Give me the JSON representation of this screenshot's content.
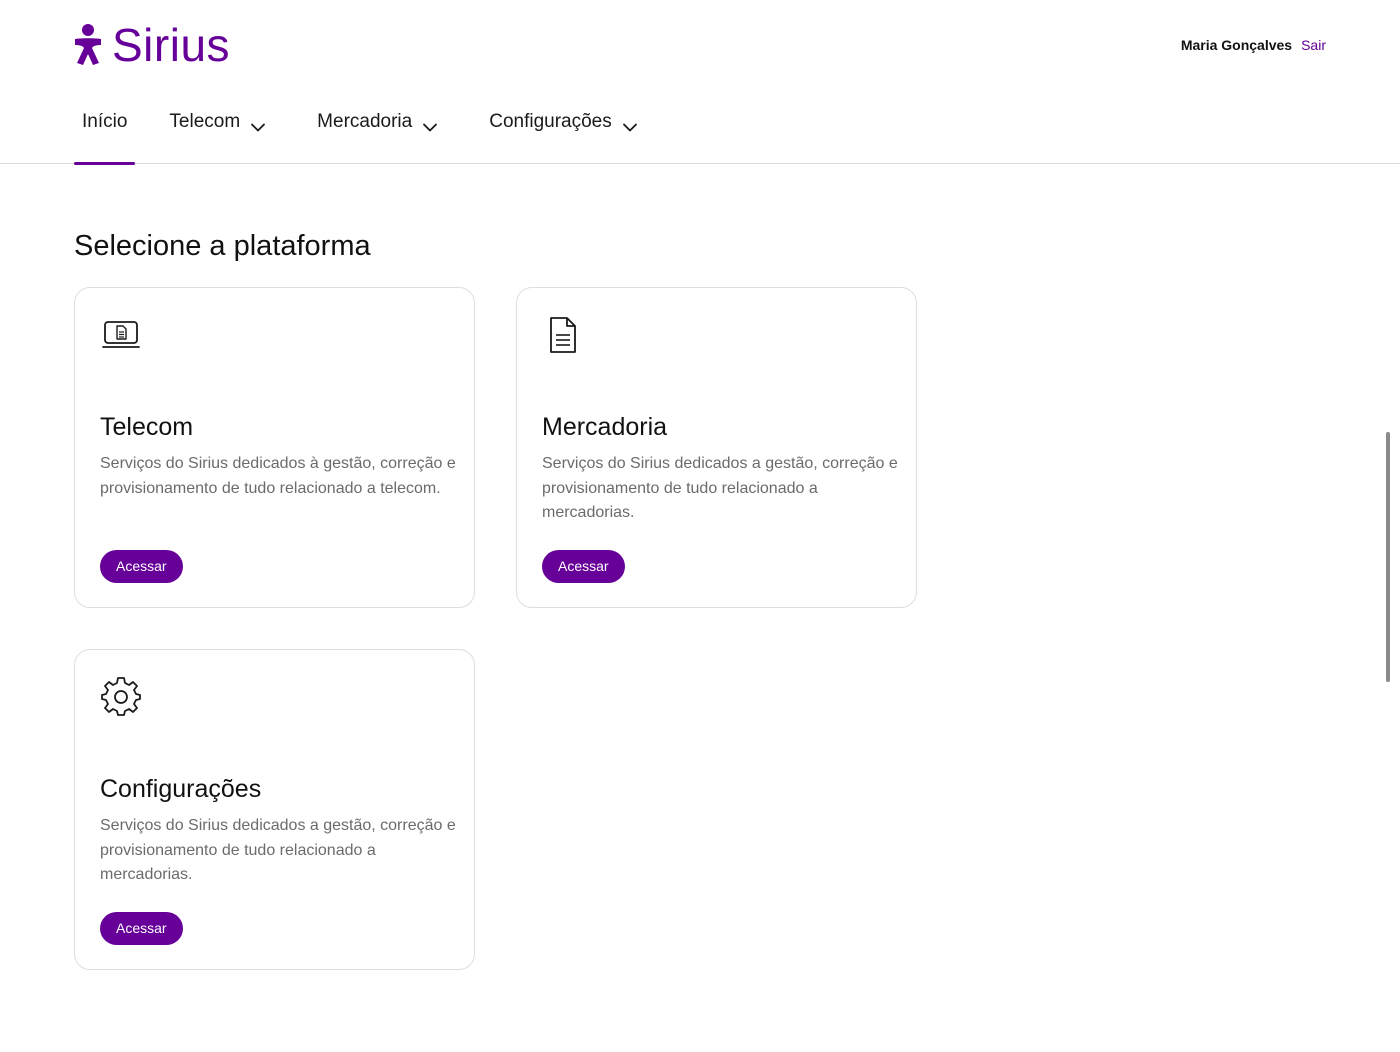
{
  "brand": {
    "name": "Sirius",
    "color": "#660099",
    "logo_icon": "person-star-icon"
  },
  "user": {
    "name": "Maria Gonçalves",
    "logout_label": "Sair"
  },
  "nav": {
    "items": [
      {
        "label": "Início",
        "active": true,
        "has_dropdown": false
      },
      {
        "label": "Telecom",
        "active": false,
        "has_dropdown": true
      },
      {
        "label": "Mercadoria",
        "active": false,
        "has_dropdown": true
      },
      {
        "label": "Configurações",
        "active": false,
        "has_dropdown": true
      }
    ]
  },
  "main": {
    "title": "Selecione a plataforma",
    "cards": [
      {
        "icon": "laptop-document-icon",
        "title": "Telecom",
        "description": "Serviços do Sirius dedicados à gestão, correção e provisionamento de tudo relacionado a telecom.",
        "button_label": "Acessar"
      },
      {
        "icon": "document-icon",
        "title": "Mercadoria",
        "description": "Serviços do Sirius dedicados a gestão, correção e provisionamento de tudo relacionado a mercadorias.",
        "button_label": "Acessar"
      },
      {
        "icon": "gear-icon",
        "title": "Configurações",
        "description": "Serviços do Sirius dedicados a gestão, correção e provisionamento de tudo relacionado a mercadorias.",
        "button_label": "Acessar"
      }
    ]
  }
}
